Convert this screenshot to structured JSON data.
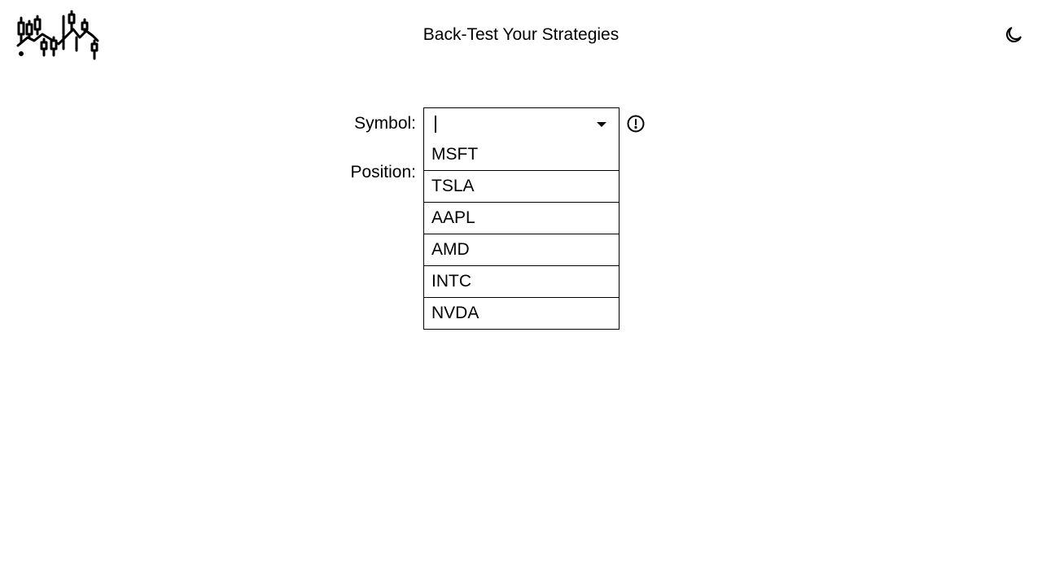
{
  "header": {
    "title": "Back-Test Your Strategies",
    "logo_icon": "candlestick-chart-logo",
    "theme_toggle_icon": "moon-icon"
  },
  "form": {
    "symbol_label": "Symbol:",
    "position_label": "Position:",
    "symbol_input": {
      "value": "",
      "dropdown_icon": "caret-down-icon",
      "status_icon": "alert-circle-icon"
    },
    "symbol_options": [
      "MSFT",
      "TSLA",
      "AAPL",
      "AMD",
      "INTC",
      "NVDA"
    ]
  }
}
